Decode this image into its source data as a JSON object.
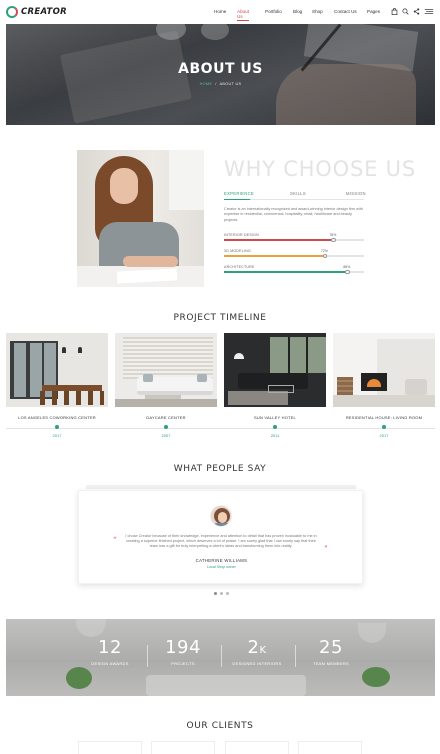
{
  "header": {
    "logo_text": "CREATOR",
    "nav": [
      "Home",
      "About Us",
      "Portfolio",
      "Blog",
      "Shop",
      "Contact Us",
      "Pages"
    ],
    "active_nav": "About Us",
    "icons": [
      "bag-icon",
      "search-icon",
      "share-icon",
      "menu-icon"
    ]
  },
  "hero": {
    "title": "ABOUT US",
    "breadcrumb_home": "HOME",
    "breadcrumb_sep": "/",
    "breadcrumb_current": "ABOUT US"
  },
  "why": {
    "title": "WHY CHOOSE US",
    "tabs": [
      "EXPERIENCE",
      "SKILLS",
      "MISSION"
    ],
    "active_tab": "EXPERIENCE",
    "description": "Creator is an internationally recognized and award-winning interior design firm with expertise in residential, commercial, hospitality, retail, healthcare and beauty projects.",
    "skills": [
      {
        "label": "INTERIOR DESIGN",
        "value": 78,
        "value_text": "78%",
        "color": "#d0494f"
      },
      {
        "label": "3D MODELING",
        "value": 72,
        "value_text": "72%",
        "color": "#e8a43a"
      },
      {
        "label": "ARCHITECTURE",
        "value": 88,
        "value_text": "88%",
        "color": "#2ea07a"
      }
    ]
  },
  "timeline": {
    "title": "PROJECT TIMELINE",
    "projects": [
      {
        "name": "LOS ANGELES COWORKING CENTER",
        "year": "2017"
      },
      {
        "name": "DAYCARE CENTER",
        "year": "2007"
      },
      {
        "name": "SUN VALLEY HOTEL",
        "year": "2011"
      },
      {
        "name": "RESIDENTIAL HOUSE: LIVING ROOM",
        "year": "2017"
      }
    ]
  },
  "testimonials": {
    "title": "WHAT PEOPLE SAY",
    "quote": "I chose Creator because of their knowledge, experience and attention to detail that has proven invaluable to me in creating a superior finished project, which deserves a lot of praise. I am surely glad that I can surely say that their team has a gift for truly interpreting a client's ideas and transforming them into reality.",
    "author": "CATHERINE WILLIAMS",
    "role": "Local Shop owner",
    "dots": 3,
    "active_dot": 0
  },
  "stats": [
    {
      "number": "12",
      "unit": "",
      "label": "DESIGN AWARDS"
    },
    {
      "number": "194",
      "unit": "",
      "label": "PROJECTS"
    },
    {
      "number": "2",
      "unit": "K",
      "label": "DESIGNED INTERIORS"
    },
    {
      "number": "25",
      "unit": "",
      "label": "TEAM MEMBERS"
    }
  ],
  "clients": {
    "title": "OUR CLIENTS"
  },
  "colors": {
    "accent_green": "#2ea07a",
    "accent_red": "#d0494f",
    "accent_orange": "#e8a43a"
  }
}
